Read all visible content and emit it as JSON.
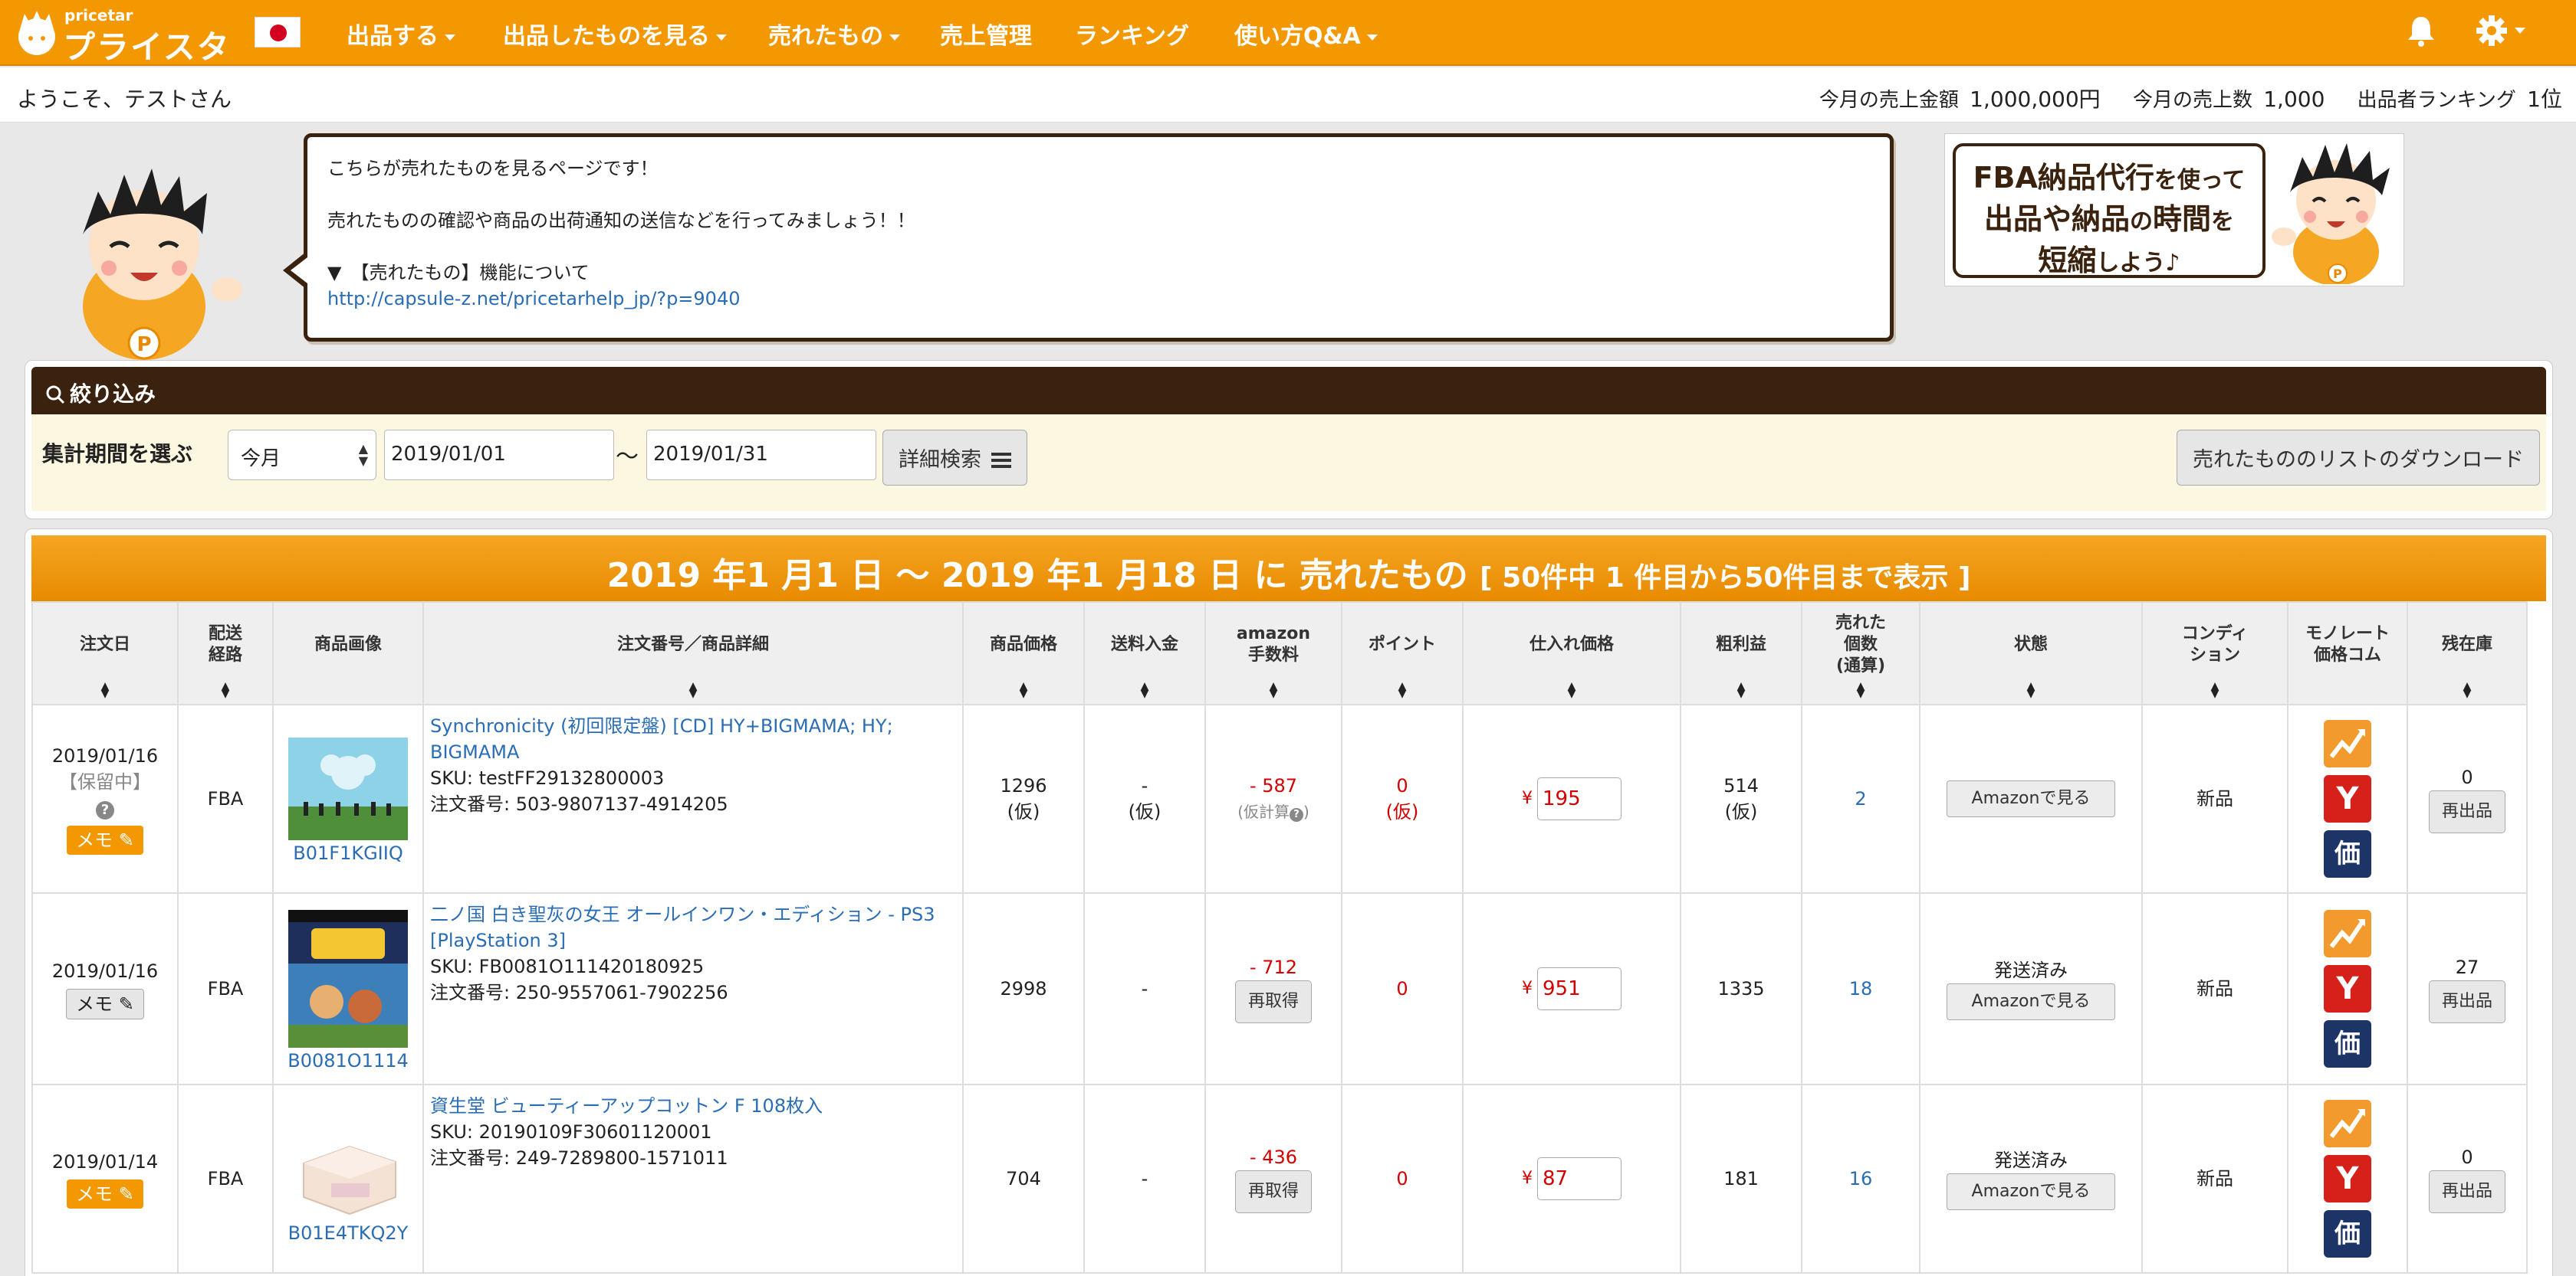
{
  "brand": {
    "sub": "pricetar",
    "main": "プライスター"
  },
  "nav": {
    "items": [
      "出品する",
      "出品したものを見る",
      "売れたもの",
      "売上管理",
      "ランキング",
      "使い方Q&A"
    ]
  },
  "welcome": {
    "greeting": "ようこそ、テストさん",
    "sales_amount_label": "今月の売上金額",
    "sales_amount": "1,000,000円",
    "sales_count_label": "今月の売上数",
    "sales_count": "1,000",
    "ranking_label": "出品者ランキング",
    "ranking": "1位"
  },
  "info": {
    "line1": "こちらが売れたものを見るページです！",
    "line2": "売れたものの確認や商品の出荷通知の送信などを行ってみましょう！！",
    "line3": "▼　【売れたもの】機能について",
    "link": "http://capsule-z.net/pricetarhelp_jp/?p=9040"
  },
  "banner": {
    "l1a": "FBA納品代行",
    "l1b": "を使って",
    "l2a": "出品や納品",
    "l2b": "の",
    "l2c": "時間",
    "l2d": "を",
    "l3a": "短縮",
    "l3b": "しよう♪"
  },
  "filter": {
    "title": "絞り込み",
    "period_label": "集計期間を選ぶ",
    "period_value": "今月",
    "date_from": "2019/01/01",
    "tilde": "〜",
    "date_to": "2019/01/31",
    "advanced": "詳細検索",
    "download": "売れたもののリストのダウンロード"
  },
  "result": {
    "title": "2019 年1 月1 日 〜 2019 年1 月18 日 に 売れたもの",
    "count": "[ 50件中 1 件目から50件目まで表示 ]"
  },
  "columns": {
    "order_date": "注文日",
    "ship1": "配送",
    "ship2": "経路",
    "image": "商品画像",
    "detail": "注文番号／商品詳細",
    "price": "商品価格",
    "shipping": "送料入金",
    "fee1": "amazon",
    "fee2": "手数料",
    "points": "ポイント",
    "cost": "仕入れ価格",
    "profit": "粗利益",
    "sold1": "売れた",
    "sold2": "個数",
    "sold3": "(通算)",
    "status": "状態",
    "cond1": "コンディ",
    "cond2": "ション",
    "mono1": "モノレート",
    "mono2": "価格コム",
    "stock": "残在庫"
  },
  "labels": {
    "memo": "メモ",
    "reacquire": "再取得",
    "relist": "再出品",
    "view_amazon": "Amazonで見る",
    "yen": "¥",
    "monorate_y": "Y",
    "kakaku": "価"
  },
  "rows": [
    {
      "date": "2019/01/16",
      "hold": "【保留中】",
      "route": "FBA",
      "asin": "B01F1KGIIQ",
      "title": "Synchronicity (初回限定盤) [CD] HY+BIGMAMA; HY; BIGMAMA",
      "sku": "SKU: testFF29132800003",
      "order_no": "注文番号: 503-9807137-4914205",
      "price": "1296",
      "price_note": "(仮)",
      "shipping": "-",
      "shipping_note": "(仮)",
      "fee": "- 587",
      "fee_note": "(仮計算",
      "points": "0",
      "points_note": "(仮)",
      "cost": "195",
      "profit": "514",
      "profit_note": "(仮)",
      "sold": "2",
      "status": "",
      "condition": "新品",
      "stock": "0"
    },
    {
      "date": "2019/01/16",
      "hold": "",
      "route": "FBA",
      "asin": "B0081O1114",
      "title": "二ノ国 白き聖灰の女王 オールインワン・エディション - PS3 [PlayStation 3]",
      "sku": "SKU: FB0081O111420180925",
      "order_no": "注文番号: 250-9557061-7902256",
      "price": "2998",
      "price_note": "",
      "shipping": "-",
      "shipping_note": "",
      "fee": "- 712",
      "fee_note": "",
      "points": "0",
      "points_note": "",
      "cost": "951",
      "profit": "1335",
      "profit_note": "",
      "sold": "18",
      "status": "発送済み",
      "condition": "新品",
      "stock": "27"
    },
    {
      "date": "2019/01/14",
      "hold": "",
      "route": "FBA",
      "asin": "B01E4TKQ2Y",
      "title": "資生堂 ビューティーアップコットン F 108枚入",
      "sku": "SKU: 20190109F30601120001",
      "order_no": "注文番号: 249-7289800-1571011",
      "price": "704",
      "price_note": "",
      "shipping": "-",
      "shipping_note": "",
      "fee": "- 436",
      "fee_note": "",
      "points": "0",
      "points_note": "",
      "cost": "87",
      "profit": "181",
      "profit_note": "",
      "sold": "16",
      "status": "発送済み",
      "condition": "新品",
      "stock": "0"
    }
  ]
}
